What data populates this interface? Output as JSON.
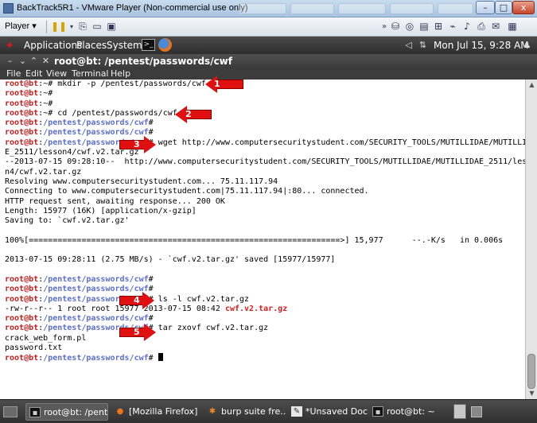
{
  "vm_window": {
    "title": "BackTrack5R1 - VMware Player (Non-commercial use only)",
    "controls": {
      "minimize": "–",
      "maximize": "□",
      "close": "x"
    }
  },
  "vm_toolbar": {
    "player_label": "Player ▾",
    "icons": [
      "pause-icon",
      "send-ctrl-alt-del-icon",
      "fullscreen-icon",
      "unity-icon",
      "devices-icon"
    ]
  },
  "gnome_panel": {
    "menus": [
      "Applications",
      "Places",
      "System"
    ],
    "clock": "Mon Jul 15,  9:28 AM"
  },
  "terminal": {
    "title": "root@bt: /pentest/passwords/cwf",
    "menus": [
      "File",
      "Edit",
      "View",
      "Terminal",
      "Help"
    ],
    "lines": [
      [
        {
          "c": "user",
          "t": "root@bt"
        },
        {
          "c": "plain",
          "t": ":~# mkdir -p /pentest/passwords/cwf"
        }
      ],
      [
        {
          "c": "user",
          "t": "root@bt"
        },
        {
          "c": "plain",
          "t": ":~#"
        }
      ],
      [
        {
          "c": "user",
          "t": "root@bt"
        },
        {
          "c": "plain",
          "t": ":~#"
        }
      ],
      [
        {
          "c": "user",
          "t": "root@bt"
        },
        {
          "c": "plain",
          "t": ":~# cd /pentest/passwords/cwf"
        }
      ],
      [
        {
          "c": "user",
          "t": "root@bt"
        },
        {
          "c": "plain",
          "t": ":"
        },
        {
          "c": "path",
          "t": "/pentest/passwords/cwf"
        },
        {
          "c": "plain",
          "t": "#"
        }
      ],
      [
        {
          "c": "user",
          "t": "root@bt"
        },
        {
          "c": "plain",
          "t": ":"
        },
        {
          "c": "path",
          "t": "/pentest/passwords/cwf"
        },
        {
          "c": "plain",
          "t": "#"
        }
      ],
      [
        {
          "c": "user",
          "t": "root@bt"
        },
        {
          "c": "plain",
          "t": ":"
        },
        {
          "c": "path",
          "t": "/pentest/passwords/cwf"
        },
        {
          "c": "plain",
          "t": "# wget http://www.computersecuritystudent.com/SECURITY_TOOLS/MUTILLIDAE/MUTILLIDA"
        }
      ],
      [
        {
          "c": "plain",
          "t": "E_2511/lesson4/cwf.v2.tar.gz"
        }
      ],
      [
        {
          "c": "plain",
          "t": "--2013-07-15 09:28:10--  http://www.computersecuritystudent.com/SECURITY_TOOLS/MUTILLIDAE/MUTILLIDAE_2511/lesso"
        }
      ],
      [
        {
          "c": "plain",
          "t": "n4/cwf.v2.tar.gz"
        }
      ],
      [
        {
          "c": "plain",
          "t": "Resolving www.computersecuritystudent.com... 75.11.117.94"
        }
      ],
      [
        {
          "c": "plain",
          "t": "Connecting to www.computersecuritystudent.com|75.11.117.94|:80... connected."
        }
      ],
      [
        {
          "c": "plain",
          "t": "HTTP request sent, awaiting response... 200 OK"
        }
      ],
      [
        {
          "c": "plain",
          "t": "Length: 15977 (16K) [application/x-gzip]"
        }
      ],
      [
        {
          "c": "plain",
          "t": "Saving to: `cwf.v2.tar.gz'"
        }
      ],
      [
        {
          "c": "plain",
          "t": ""
        }
      ],
      [
        {
          "c": "plain",
          "t": "100%[=================================================================>] 15,977      --.-K/s   in 0.006s"
        }
      ],
      [
        {
          "c": "plain",
          "t": ""
        }
      ],
      [
        {
          "c": "plain",
          "t": "2013-07-15 09:28:11 (2.75 MB/s) - `cwf.v2.tar.gz' saved [15977/15977]"
        }
      ],
      [
        {
          "c": "plain",
          "t": ""
        }
      ],
      [
        {
          "c": "user",
          "t": "root@bt"
        },
        {
          "c": "plain",
          "t": ":"
        },
        {
          "c": "path",
          "t": "/pentest/passwords/cwf"
        },
        {
          "c": "plain",
          "t": "#"
        }
      ],
      [
        {
          "c": "user",
          "t": "root@bt"
        },
        {
          "c": "plain",
          "t": ":"
        },
        {
          "c": "path",
          "t": "/pentest/passwords/cwf"
        },
        {
          "c": "plain",
          "t": "#"
        }
      ],
      [
        {
          "c": "user",
          "t": "root@bt"
        },
        {
          "c": "plain",
          "t": ":"
        },
        {
          "c": "path",
          "t": "/pentest/passwords/cwf"
        },
        {
          "c": "plain",
          "t": "# ls -l cwf.v2.tar.gz"
        }
      ],
      [
        {
          "c": "plain",
          "t": "-rw-r--r-- 1 root root 15977 2013-07-15 08:42 "
        },
        {
          "c": "red",
          "t": "cwf.v2.tar.gz"
        }
      ],
      [
        {
          "c": "user",
          "t": "root@bt"
        },
        {
          "c": "plain",
          "t": ":"
        },
        {
          "c": "path",
          "t": "/pentest/passwords/cwf"
        },
        {
          "c": "plain",
          "t": "#"
        }
      ],
      [
        {
          "c": "user",
          "t": "root@bt"
        },
        {
          "c": "plain",
          "t": ":"
        },
        {
          "c": "path",
          "t": "/pentest/passwords/cwf"
        },
        {
          "c": "plain",
          "t": "# tar zxovf cwf.v2.tar.gz"
        }
      ],
      [
        {
          "c": "plain",
          "t": "crack_web_form.pl"
        }
      ],
      [
        {
          "c": "plain",
          "t": "password.txt"
        }
      ],
      [
        {
          "c": "user",
          "t": "root@bt"
        },
        {
          "c": "plain",
          "t": ":"
        },
        {
          "c": "path",
          "t": "/pentest/passwords/cwf"
        },
        {
          "c": "plain",
          "t": "# "
        },
        {
          "c": "cursor",
          "t": ""
        }
      ]
    ]
  },
  "annotations": [
    "1",
    "2",
    "3",
    "4",
    "5"
  ],
  "taskbar": {
    "tasks": [
      {
        "label": "root@bt: /pent...",
        "icon": "terminal-icon",
        "active": true
      },
      {
        "label": "[Mozilla Firefox]",
        "icon": "firefox-icon",
        "active": false
      },
      {
        "label": "burp suite fre...",
        "icon": "burp-icon",
        "active": false
      },
      {
        "label": "*Unsaved Doc...",
        "icon": "editor-icon",
        "active": false
      },
      {
        "label": "root@bt: ~",
        "icon": "terminal-icon",
        "active": false
      }
    ]
  },
  "colors": {
    "prompt_user": "#c41d1d",
    "prompt_path": "#5c6ed0",
    "arrow": "#e01010"
  }
}
